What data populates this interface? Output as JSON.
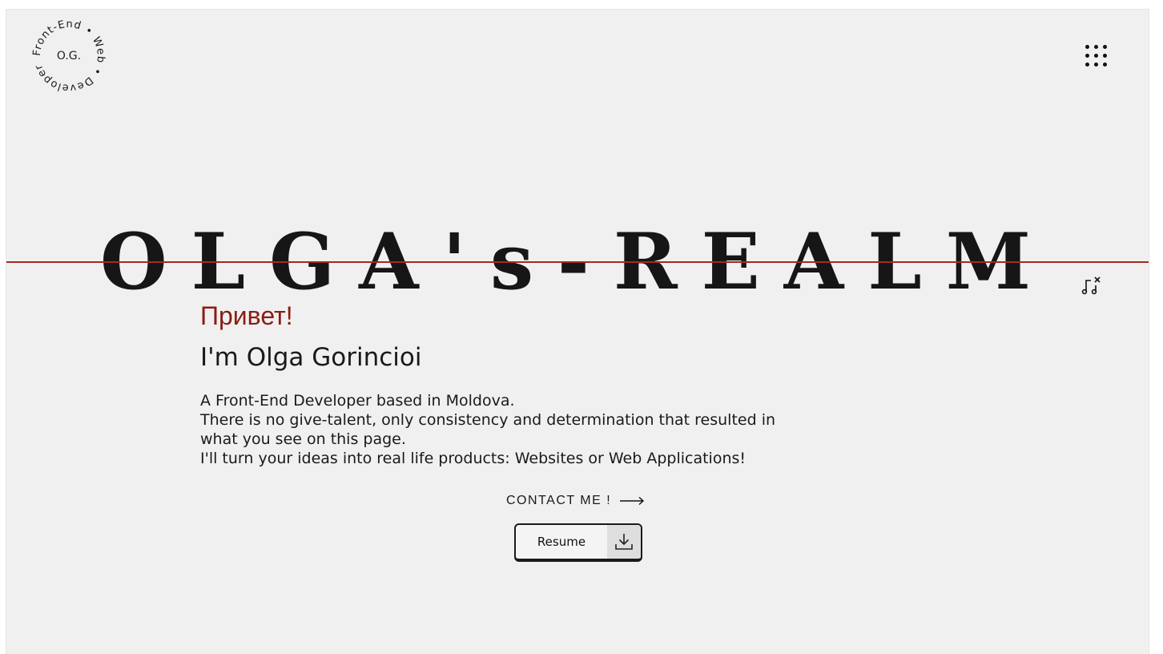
{
  "logo": {
    "center_text": "O.G.",
    "ring_text": "Front-End • Web • Developer •"
  },
  "header": {
    "menu_icon": "dots-grid-icon"
  },
  "hero": {
    "title": "OLGA's-REALM"
  },
  "audio": {
    "icon": "music-mute-icon"
  },
  "intro": {
    "greeting": "Привет!",
    "name": "I'm Olga Gorincioi",
    "bio_lines": [
      "A Front-End Developer based in Moldova.",
      "There is no give-talent, only consistency and determination that resulted in what you see on this page.",
      "I'll turn your ideas into real life products: Websites or Web Applications!"
    ]
  },
  "actions": {
    "contact_label": "CONTACT ME !",
    "contact_icon": "long-arrow-right-icon",
    "resume_label": "Resume",
    "resume_icon": "download-icon"
  },
  "colors": {
    "accent": "#8a1d14",
    "rule": "#a8281e",
    "background": "#f0f0f0",
    "text": "#1a1a1a"
  }
}
